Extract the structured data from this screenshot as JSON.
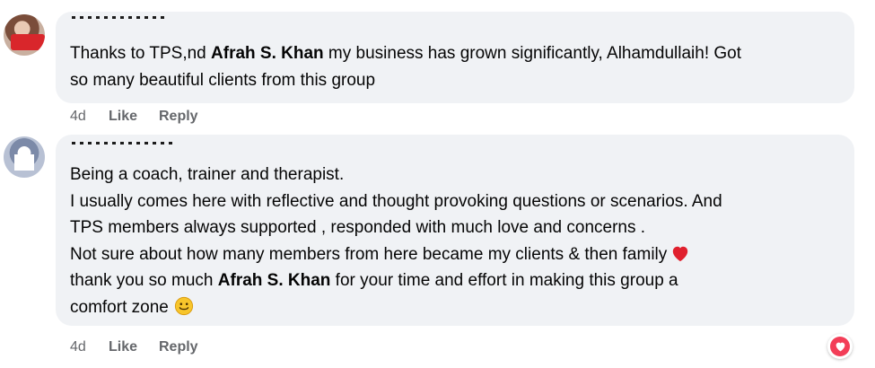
{
  "comments": [
    {
      "lines": [
        [
          {
            "t": "Thanks to TPS,nd "
          },
          {
            "m": "Afrah S. Khan"
          },
          {
            "t": " my business has grown significantly, Alhamdullaih! Got"
          }
        ],
        [
          {
            "t": "so many beautiful clients from this group"
          }
        ]
      ],
      "time": "4d",
      "like": "Like",
      "reply": "Reply"
    },
    {
      "lines": [
        [
          {
            "t": "Being a coach, trainer and therapist."
          }
        ],
        [
          {
            "t": "I usually comes here with reflective and thought provoking questions or scenarios. And"
          }
        ],
        [
          {
            "t": "TPS members always supported , responded with much love and concerns ."
          }
        ],
        [
          {
            "t": "Not sure about how many members from here became my clients & then family"
          },
          {
            "e": "heart"
          }
        ],
        [
          {
            "t": "thank you so much "
          },
          {
            "m": "Afrah S. Khan"
          },
          {
            "t": " for your time and effort in making this group a"
          }
        ],
        [
          {
            "t": "comfort zone"
          },
          {
            "e": "smile"
          }
        ]
      ],
      "time": "4d",
      "like": "Like",
      "reply": "Reply",
      "reaction_icon": "love-reaction-icon"
    }
  ],
  "colors": {
    "bubble": "#f0f2f5",
    "text": "#050505",
    "meta": "#65676b",
    "love": "#f33e58"
  }
}
